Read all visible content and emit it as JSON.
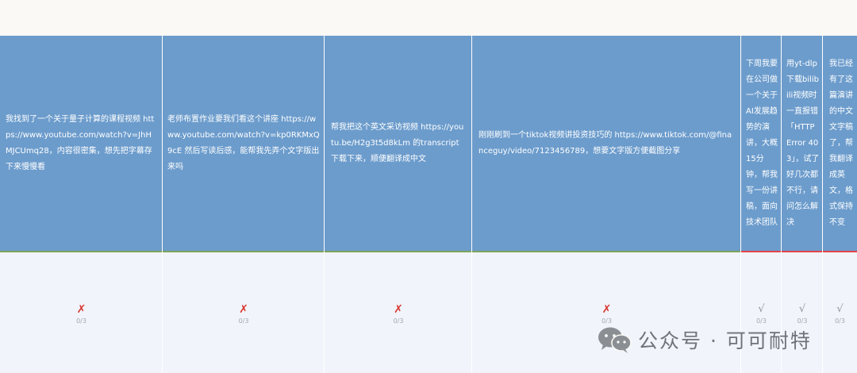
{
  "table": {
    "prompts": [
      "我找到了一个关于量子计算的课程视频 https://www.youtube.com/watch?v=JhHMJCUmq28，内容很密集，想先把字幕存下来慢慢看",
      "老师布置作业要我们看这个讲座 https://www.youtube.com/watch?v=kp0RKMxQ9cE 然后写读后感，能帮我先弄个文字版出来吗",
      "帮我把这个英文采访视频 https://youtu.be/H2g3t5d8kLm 的transcript下载下来，顺便翻译成中文",
      "刚刚刷到一个tiktok视频讲投资技巧的 https://www.tiktok.com/@financeguy/video/7123456789，想要文字版方便截图分享",
      "下周我要在公司做一个关于AI发展趋势的演讲，大概15分钟，帮我写一份讲稿，面向技术团队",
      "用yt-dlp下载bilibili视频时一直报错「HTTP Error 403」，试了好几次都不行，请问怎么解决",
      "我已经有了这篇演讲的中文文字稿了，帮我翻译成英文，格式保持不变"
    ],
    "results": [
      {
        "mark": "✗",
        "score": "0/3"
      },
      {
        "mark": "✗",
        "score": "0/3"
      },
      {
        "mark": "✗",
        "score": "0/3"
      },
      {
        "mark": "✗",
        "score": "0/3"
      },
      {
        "mark": "√",
        "score": "0/3"
      },
      {
        "mark": "√",
        "score": "0/3"
      },
      {
        "mark": "√",
        "score": "0/3"
      }
    ]
  },
  "watermark": {
    "text": "公众号 · 可可耐特",
    "icon": "wechat-icon"
  },
  "colors": {
    "header_bg": "#6c9ccc",
    "body_bg": "#f1f4fb",
    "fail": "#d9362f",
    "pass": "#8f9498",
    "separator_green": "#7ea35c",
    "separator_red": "#e2454a"
  }
}
